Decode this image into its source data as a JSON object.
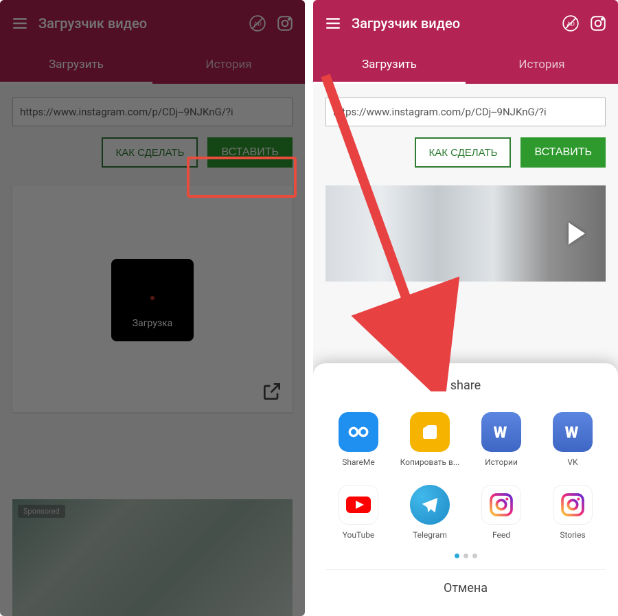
{
  "header": {
    "title": "Загрузчик видео"
  },
  "tabs": {
    "download": "Загрузить",
    "history": "История"
  },
  "url": "https://www.instagram.com/p/CDj--9NJKnG/?i",
  "buttons": {
    "howto": "КАК СДЕЛАТЬ",
    "paste": "ВСТАВИТЬ"
  },
  "loading": "Загрузка",
  "sponsored": "Sponsored",
  "share": {
    "title": "share",
    "cancel": "Отмена",
    "items": [
      {
        "id": "shareme",
        "label": "ShareMe",
        "color": "#1f8ff0"
      },
      {
        "id": "copy",
        "label": "Копировать в...",
        "color": "#f6b400"
      },
      {
        "id": "stories-vk",
        "label": "Истории",
        "color": "#4b76d1"
      },
      {
        "id": "vk",
        "label": "VK",
        "color": "#4b76d1"
      },
      {
        "id": "youtube",
        "label": "YouTube",
        "color": "#ffffff"
      },
      {
        "id": "telegram",
        "label": "Telegram",
        "color": "#2ca7df"
      },
      {
        "id": "feed",
        "label": "Feed",
        "color": "#ffffff"
      },
      {
        "id": "storiesig",
        "label": "Stories",
        "color": "#ffffff"
      }
    ]
  }
}
